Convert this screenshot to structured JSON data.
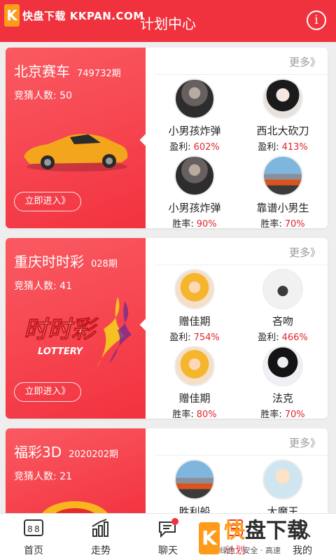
{
  "header": {
    "watermark": "快盘下载 KKPAN.COM",
    "watermark_logo": "K",
    "title": "计划中心",
    "info_icon": "i"
  },
  "cards": [
    {
      "name": "北京赛车",
      "issue": "749732期",
      "guess": "竞猜人数: 50",
      "more": "更多》",
      "enter": "立即进入》",
      "players": [
        {
          "name": "小男孩炸弹",
          "stat_label": "盈利:",
          "stat_value": "602%"
        },
        {
          "name": "西北大砍刀",
          "stat_label": "盈利:",
          "stat_value": "413%"
        },
        {
          "name": "小男孩炸弹",
          "stat_label": "胜率:",
          "stat_value": "90%"
        },
        {
          "name": "靠谱小男生",
          "stat_label": "胜率:",
          "stat_value": "70%"
        }
      ]
    },
    {
      "name": "重庆时时彩",
      "issue": "028期",
      "guess": "竞猜人数: 41",
      "more": "更多》",
      "enter": "立即进入》",
      "art_text": "时时彩",
      "art_sub": "LOTTERY",
      "players": [
        {
          "name": "赠佳期",
          "stat_label": "盈利:",
          "stat_value": "754%"
        },
        {
          "name": "吝吻",
          "stat_label": "盈利:",
          "stat_value": "466%"
        },
        {
          "name": "赠佳期",
          "stat_label": "胜率:",
          "stat_value": "80%"
        },
        {
          "name": "法克",
          "stat_label": "胜率:",
          "stat_value": "70%"
        }
      ]
    },
    {
      "name": "福彩3D",
      "issue": "2020202期",
      "guess": "竞猜人数: 21",
      "more": "更多》",
      "players": [
        {
          "name": "胜利船"
        },
        {
          "name": "大魔王"
        }
      ]
    }
  ],
  "nav": [
    {
      "label": "首页",
      "icon": "home-icon"
    },
    {
      "label": "走势",
      "icon": "trend-icon"
    },
    {
      "label": "聊天",
      "icon": "chat-icon"
    },
    {
      "label": "计划",
      "icon": "plan-icon"
    },
    {
      "label": "我的",
      "icon": "profile-icon"
    }
  ],
  "ad": {
    "logo": "K",
    "kuai": "快",
    "rest": "盘下载",
    "tagline": "绿色 · 安全 · 高速"
  },
  "colors": {
    "accent": "#f0323e",
    "profit": "#e0262f",
    "watermark": "#ff9b1a"
  }
}
